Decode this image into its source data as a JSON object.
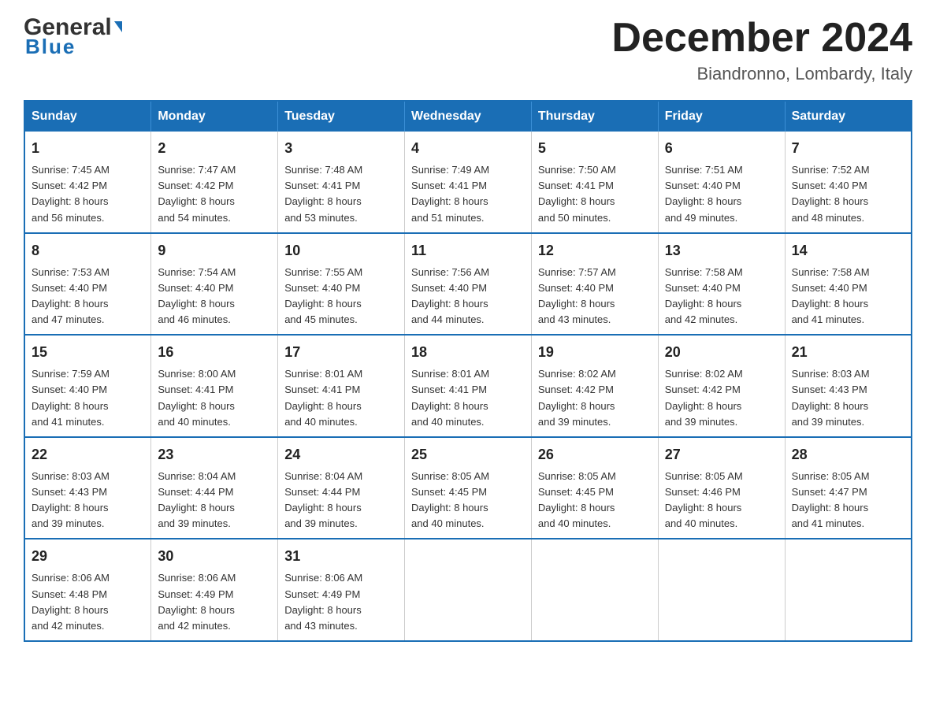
{
  "header": {
    "logo": {
      "general": "General",
      "blue": "Blue",
      "triangle": "▶"
    },
    "title": "December 2024",
    "location": "Biandronno, Lombardy, Italy"
  },
  "days_of_week": [
    "Sunday",
    "Monday",
    "Tuesday",
    "Wednesday",
    "Thursday",
    "Friday",
    "Saturday"
  ],
  "weeks": [
    [
      {
        "day": "1",
        "sunrise": "7:45 AM",
        "sunset": "4:42 PM",
        "daylight": "8 hours and 56 minutes."
      },
      {
        "day": "2",
        "sunrise": "7:47 AM",
        "sunset": "4:42 PM",
        "daylight": "8 hours and 54 minutes."
      },
      {
        "day": "3",
        "sunrise": "7:48 AM",
        "sunset": "4:41 PM",
        "daylight": "8 hours and 53 minutes."
      },
      {
        "day": "4",
        "sunrise": "7:49 AM",
        "sunset": "4:41 PM",
        "daylight": "8 hours and 51 minutes."
      },
      {
        "day": "5",
        "sunrise": "7:50 AM",
        "sunset": "4:41 PM",
        "daylight": "8 hours and 50 minutes."
      },
      {
        "day": "6",
        "sunrise": "7:51 AM",
        "sunset": "4:40 PM",
        "daylight": "8 hours and 49 minutes."
      },
      {
        "day": "7",
        "sunrise": "7:52 AM",
        "sunset": "4:40 PM",
        "daylight": "8 hours and 48 minutes."
      }
    ],
    [
      {
        "day": "8",
        "sunrise": "7:53 AM",
        "sunset": "4:40 PM",
        "daylight": "8 hours and 47 minutes."
      },
      {
        "day": "9",
        "sunrise": "7:54 AM",
        "sunset": "4:40 PM",
        "daylight": "8 hours and 46 minutes."
      },
      {
        "day": "10",
        "sunrise": "7:55 AM",
        "sunset": "4:40 PM",
        "daylight": "8 hours and 45 minutes."
      },
      {
        "day": "11",
        "sunrise": "7:56 AM",
        "sunset": "4:40 PM",
        "daylight": "8 hours and 44 minutes."
      },
      {
        "day": "12",
        "sunrise": "7:57 AM",
        "sunset": "4:40 PM",
        "daylight": "8 hours and 43 minutes."
      },
      {
        "day": "13",
        "sunrise": "7:58 AM",
        "sunset": "4:40 PM",
        "daylight": "8 hours and 42 minutes."
      },
      {
        "day": "14",
        "sunrise": "7:58 AM",
        "sunset": "4:40 PM",
        "daylight": "8 hours and 41 minutes."
      }
    ],
    [
      {
        "day": "15",
        "sunrise": "7:59 AM",
        "sunset": "4:40 PM",
        "daylight": "8 hours and 41 minutes."
      },
      {
        "day": "16",
        "sunrise": "8:00 AM",
        "sunset": "4:41 PM",
        "daylight": "8 hours and 40 minutes."
      },
      {
        "day": "17",
        "sunrise": "8:01 AM",
        "sunset": "4:41 PM",
        "daylight": "8 hours and 40 minutes."
      },
      {
        "day": "18",
        "sunrise": "8:01 AM",
        "sunset": "4:41 PM",
        "daylight": "8 hours and 40 minutes."
      },
      {
        "day": "19",
        "sunrise": "8:02 AM",
        "sunset": "4:42 PM",
        "daylight": "8 hours and 39 minutes."
      },
      {
        "day": "20",
        "sunrise": "8:02 AM",
        "sunset": "4:42 PM",
        "daylight": "8 hours and 39 minutes."
      },
      {
        "day": "21",
        "sunrise": "8:03 AM",
        "sunset": "4:43 PM",
        "daylight": "8 hours and 39 minutes."
      }
    ],
    [
      {
        "day": "22",
        "sunrise": "8:03 AM",
        "sunset": "4:43 PM",
        "daylight": "8 hours and 39 minutes."
      },
      {
        "day": "23",
        "sunrise": "8:04 AM",
        "sunset": "4:44 PM",
        "daylight": "8 hours and 39 minutes."
      },
      {
        "day": "24",
        "sunrise": "8:04 AM",
        "sunset": "4:44 PM",
        "daylight": "8 hours and 39 minutes."
      },
      {
        "day": "25",
        "sunrise": "8:05 AM",
        "sunset": "4:45 PM",
        "daylight": "8 hours and 40 minutes."
      },
      {
        "day": "26",
        "sunrise": "8:05 AM",
        "sunset": "4:45 PM",
        "daylight": "8 hours and 40 minutes."
      },
      {
        "day": "27",
        "sunrise": "8:05 AM",
        "sunset": "4:46 PM",
        "daylight": "8 hours and 40 minutes."
      },
      {
        "day": "28",
        "sunrise": "8:05 AM",
        "sunset": "4:47 PM",
        "daylight": "8 hours and 41 minutes."
      }
    ],
    [
      {
        "day": "29",
        "sunrise": "8:06 AM",
        "sunset": "4:48 PM",
        "daylight": "8 hours and 42 minutes."
      },
      {
        "day": "30",
        "sunrise": "8:06 AM",
        "sunset": "4:49 PM",
        "daylight": "8 hours and 42 minutes."
      },
      {
        "day": "31",
        "sunrise": "8:06 AM",
        "sunset": "4:49 PM",
        "daylight": "8 hours and 43 minutes."
      },
      null,
      null,
      null,
      null
    ]
  ],
  "labels": {
    "sunrise": "Sunrise:",
    "sunset": "Sunset:",
    "daylight": "Daylight:"
  }
}
